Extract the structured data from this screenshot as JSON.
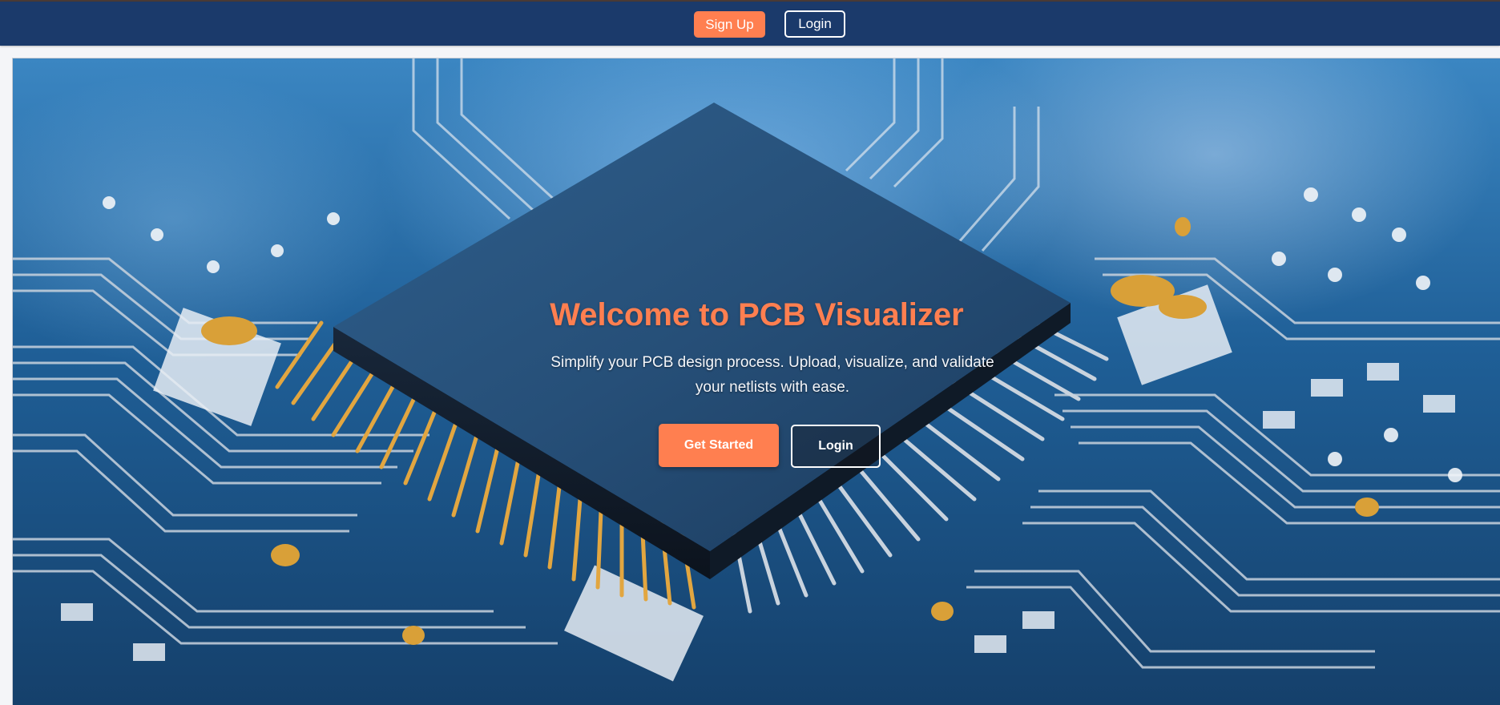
{
  "navbar": {
    "signup_label": "Sign Up",
    "login_label": "Login"
  },
  "hero": {
    "title": "Welcome to PCB Visualizer",
    "subtitle": "Simplify your PCB design process. Upload, visualize, and validate your netlists with ease.",
    "get_started_label": "Get Started",
    "login_label": "Login",
    "background_image": "circuit-board-chip-photo"
  },
  "colors": {
    "navbar": "#1b3a6b",
    "accent": "#ff7f50",
    "board_blue": "#1f5f97"
  }
}
